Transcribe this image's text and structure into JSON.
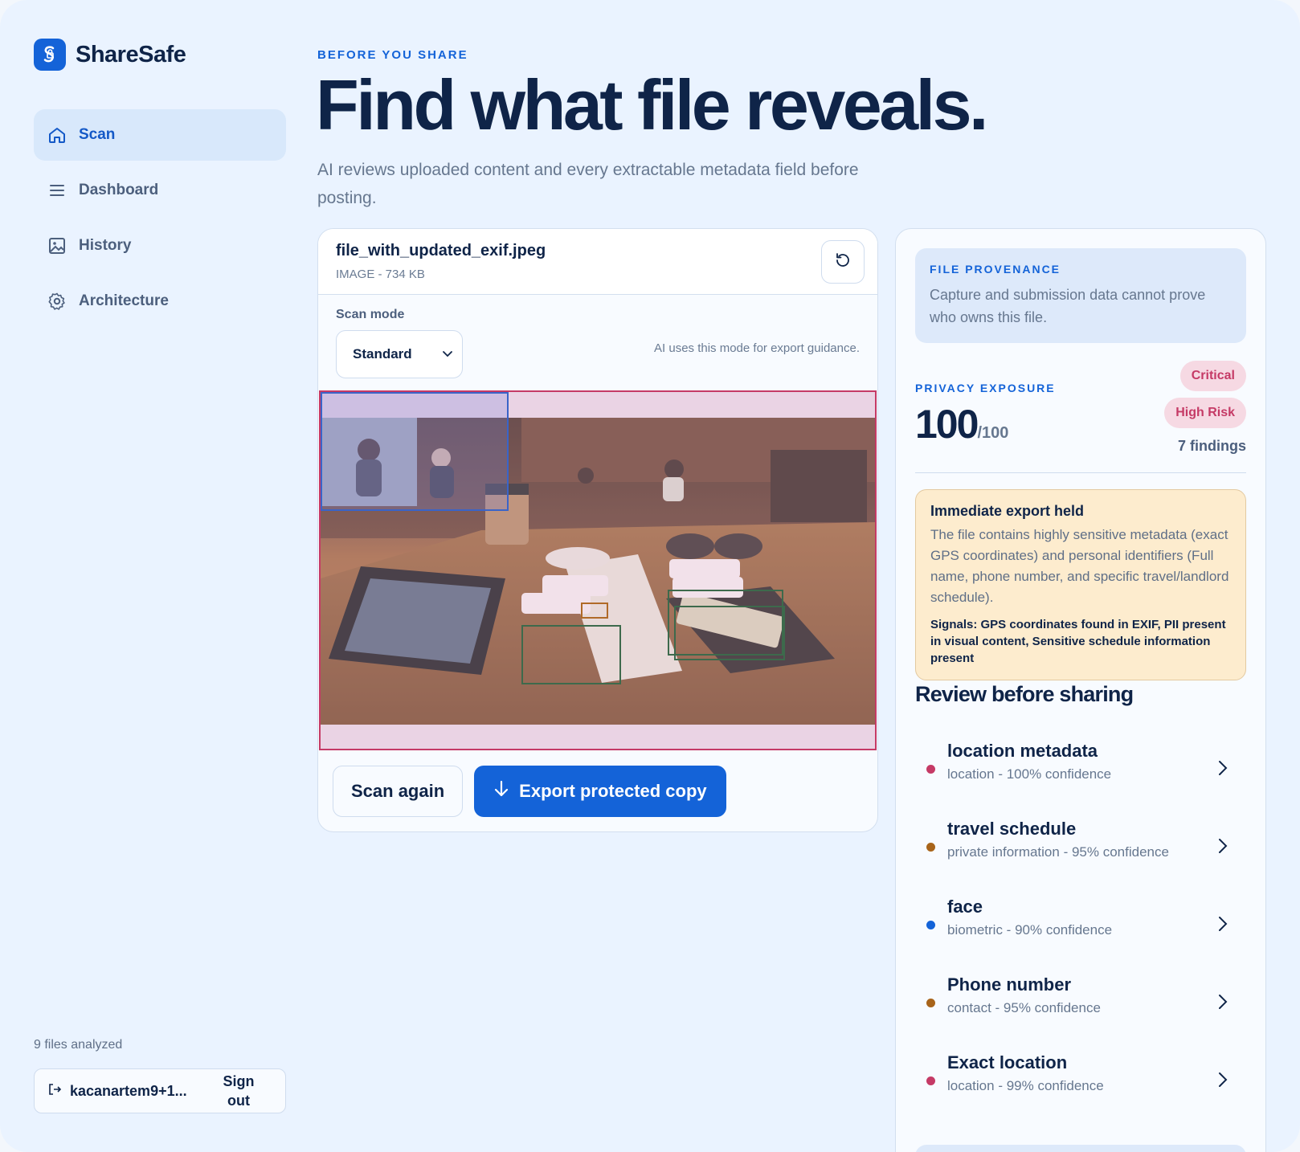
{
  "app": {
    "name": "ShareSafe"
  },
  "sidebar": {
    "items": [
      {
        "label": "Scan",
        "icon": "home-icon",
        "active": true
      },
      {
        "label": "Dashboard",
        "icon": "menu-icon",
        "active": false
      },
      {
        "label": "History",
        "icon": "image-icon",
        "active": false
      },
      {
        "label": "Architecture",
        "icon": "gear-icon",
        "active": false
      }
    ],
    "files_analyzed": "9 files analyzed",
    "account": {
      "user": "kacanartem9+1...",
      "sign_out": "Sign out"
    }
  },
  "header": {
    "eyebrow": "BEFORE YOU SHARE",
    "title": "Find what file reveals.",
    "subtitle": "AI reviews uploaded content and every extractable metadata field before posting."
  },
  "file": {
    "name": "file_with_updated_exif.jpeg",
    "meta": "IMAGE - 734 KB",
    "scan_mode_label": "Scan mode",
    "scan_mode_value": "Standard",
    "scan_mode_hint": "AI uses this mode for export guidance.",
    "scan_again": "Scan again",
    "export": "Export protected copy"
  },
  "provenance": {
    "label": "FILE PROVENANCE",
    "text": "Capture and submission data cannot prove who owns this file."
  },
  "exposure": {
    "label": "PRIVACY EXPOSURE",
    "score": "100",
    "max": "/100",
    "badge_critical": "Critical",
    "badge_risk": "High Risk",
    "findings": "7 findings"
  },
  "warning": {
    "title": "Immediate export held",
    "body": "The file contains highly sensitive metadata (exact GPS coordinates) and personal identifiers (Full name, phone number, and specific travel/landlord schedule).",
    "signals": "Signals: GPS coordinates found in EXIF, PII present in visual content, Sensitive schedule information present"
  },
  "review": {
    "title": "Review before sharing",
    "items": [
      {
        "title": "location metadata",
        "sub": "location - 100% confidence",
        "color": "#c53a66"
      },
      {
        "title": "travel schedule",
        "sub": "private information - 95% confidence",
        "color": "#a8641a"
      },
      {
        "title": "face",
        "sub": "biometric - 90% confidence",
        "color": "#1463d8"
      },
      {
        "title": "Phone number",
        "sub": "contact - 95% confidence",
        "color": "#a8641a"
      },
      {
        "title": "Exact location",
        "sub": "location - 99% confidence",
        "color": "#c53a66"
      }
    ]
  },
  "colors": {
    "accent": "#1463d8",
    "danger": "#c53a66",
    "warn_bg": "#fdecce",
    "ink": "#0f2448"
  }
}
